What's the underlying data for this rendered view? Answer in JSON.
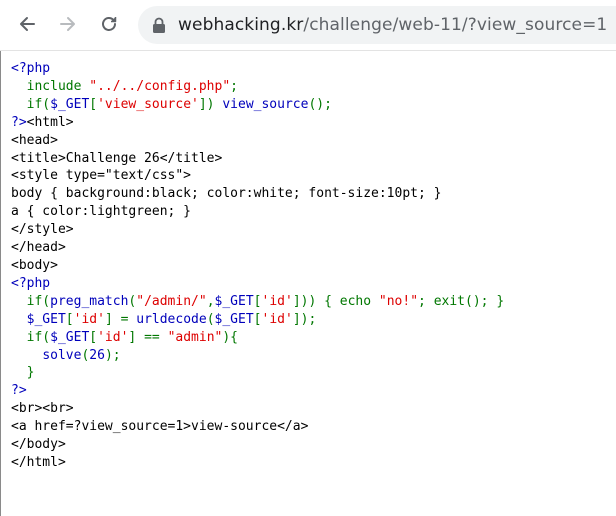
{
  "browser": {
    "url_host": "webhacking.kr",
    "url_path": "/challenge/web-11/?view_source=1",
    "back_icon": "arrow-left-icon",
    "forward_icon": "arrow-right-icon",
    "reload_icon": "reload-icon",
    "lock_icon": "lock-icon"
  },
  "source_lines": [
    [
      {
        "t": "<?php",
        "c": "tag"
      }
    ],
    [
      {
        "t": "  ",
        "c": "plain"
      },
      {
        "t": "include ",
        "c": "kw"
      },
      {
        "t": "\"../../config.php\"",
        "c": "str"
      },
      {
        "t": ";",
        "c": "kw"
      }
    ],
    [
      {
        "t": "  ",
        "c": "plain"
      },
      {
        "t": "if(",
        "c": "kw"
      },
      {
        "t": "$_GET",
        "c": "def"
      },
      {
        "t": "[",
        "c": "kw"
      },
      {
        "t": "'view_source'",
        "c": "str"
      },
      {
        "t": "]) ",
        "c": "kw"
      },
      {
        "t": "view_source",
        "c": "def"
      },
      {
        "t": "();",
        "c": "kw"
      }
    ],
    [
      {
        "t": "?>",
        "c": "tag"
      },
      {
        "t": "<html>",
        "c": "plain"
      }
    ],
    [
      {
        "t": "<head>",
        "c": "plain"
      }
    ],
    [
      {
        "t": "<title>Challenge 26</title>",
        "c": "plain"
      }
    ],
    [
      {
        "t": "<style type=\"text/css\">",
        "c": "plain"
      }
    ],
    [
      {
        "t": "body { background:black; color:white; font-size:10pt; }",
        "c": "plain"
      }
    ],
    [
      {
        "t": "a { color:lightgreen; }",
        "c": "plain"
      }
    ],
    [
      {
        "t": "</style>",
        "c": "plain"
      }
    ],
    [
      {
        "t": "</head>",
        "c": "plain"
      }
    ],
    [
      {
        "t": "<body>",
        "c": "plain"
      }
    ],
    [
      {
        "t": "<?php",
        "c": "tag"
      }
    ],
    [
      {
        "t": "  ",
        "c": "plain"
      },
      {
        "t": "if(",
        "c": "kw"
      },
      {
        "t": "preg_match",
        "c": "def"
      },
      {
        "t": "(",
        "c": "kw"
      },
      {
        "t": "\"/admin/\"",
        "c": "str"
      },
      {
        "t": ",",
        "c": "kw"
      },
      {
        "t": "$_GET",
        "c": "def"
      },
      {
        "t": "[",
        "c": "kw"
      },
      {
        "t": "'id'",
        "c": "str"
      },
      {
        "t": "])) { echo ",
        "c": "kw"
      },
      {
        "t": "\"no!\"",
        "c": "str"
      },
      {
        "t": "; exit(); }",
        "c": "kw"
      }
    ],
    [
      {
        "t": "  ",
        "c": "plain"
      },
      {
        "t": "$_GET",
        "c": "def"
      },
      {
        "t": "[",
        "c": "kw"
      },
      {
        "t": "'id'",
        "c": "str"
      },
      {
        "t": "] = ",
        "c": "kw"
      },
      {
        "t": "urldecode",
        "c": "def"
      },
      {
        "t": "(",
        "c": "kw"
      },
      {
        "t": "$_GET",
        "c": "def"
      },
      {
        "t": "[",
        "c": "kw"
      },
      {
        "t": "'id'",
        "c": "str"
      },
      {
        "t": "]);",
        "c": "kw"
      }
    ],
    [
      {
        "t": "  ",
        "c": "plain"
      },
      {
        "t": "if(",
        "c": "kw"
      },
      {
        "t": "$_GET",
        "c": "def"
      },
      {
        "t": "[",
        "c": "kw"
      },
      {
        "t": "'id'",
        "c": "str"
      },
      {
        "t": "] == ",
        "c": "kw"
      },
      {
        "t": "\"admin\"",
        "c": "str"
      },
      {
        "t": "){",
        "c": "kw"
      }
    ],
    [
      {
        "t": "    ",
        "c": "plain"
      },
      {
        "t": "solve",
        "c": "def"
      },
      {
        "t": "(",
        "c": "kw"
      },
      {
        "t": "26",
        "c": "def"
      },
      {
        "t": ");",
        "c": "kw"
      }
    ],
    [
      {
        "t": "  ",
        "c": "plain"
      },
      {
        "t": "}",
        "c": "kw"
      }
    ],
    [
      {
        "t": "?>",
        "c": "tag"
      }
    ],
    [
      {
        "t": "<br><br>",
        "c": "plain"
      }
    ],
    [
      {
        "t": "<a href=?view_source=1>view-source</a>",
        "c": "plain"
      }
    ],
    [
      {
        "t": "</body>",
        "c": "plain"
      }
    ],
    [
      {
        "t": "</html>",
        "c": "plain"
      }
    ]
  ],
  "colors": {
    "tag": "#0000bb",
    "string": "#dd0000",
    "keyword": "#007700",
    "default": "#0000bb",
    "plain": "#000000"
  }
}
